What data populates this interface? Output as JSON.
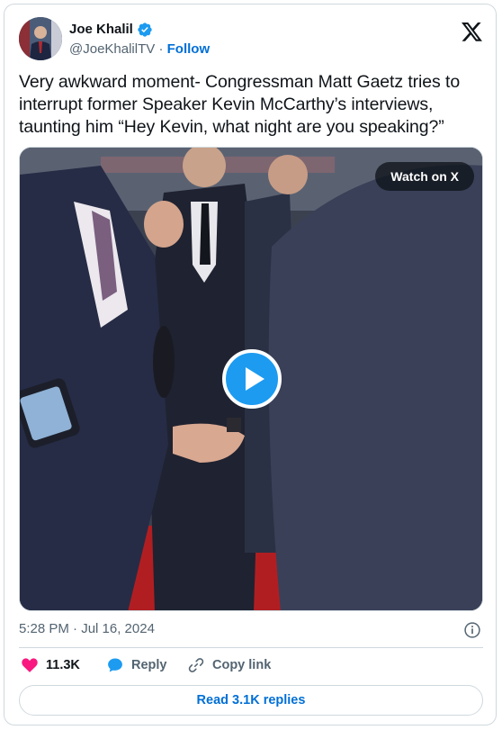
{
  "author": {
    "display_name": "Joe Khalil",
    "handle": "@JoeKhalilTV",
    "separator": "·",
    "follow_label": "Follow"
  },
  "tweet": {
    "text": "Very awkward moment- Congressman Matt Gaetz tries to interrupt former Speaker Kevin McCarthy’s interviews, taunting him “Hey Kevin, what night are you speaking?”",
    "timestamp": "5:28 PM · Jul 16, 2024"
  },
  "media": {
    "watch_label": "Watch on X"
  },
  "actions": {
    "likes": "11.3K",
    "reply_label": "Reply",
    "copy_label": "Copy link",
    "read_replies_label": "Read 3.1K replies"
  },
  "colors": {
    "accent_blue": "#1d9bf0",
    "like_pink": "#f91880",
    "link_blue": "#006fd6",
    "muted": "#536471"
  },
  "icons": [
    "verified-badge-icon",
    "x-logo-icon",
    "play-icon",
    "info-icon",
    "heart-icon",
    "reply-bubble-icon",
    "copy-link-icon"
  ]
}
